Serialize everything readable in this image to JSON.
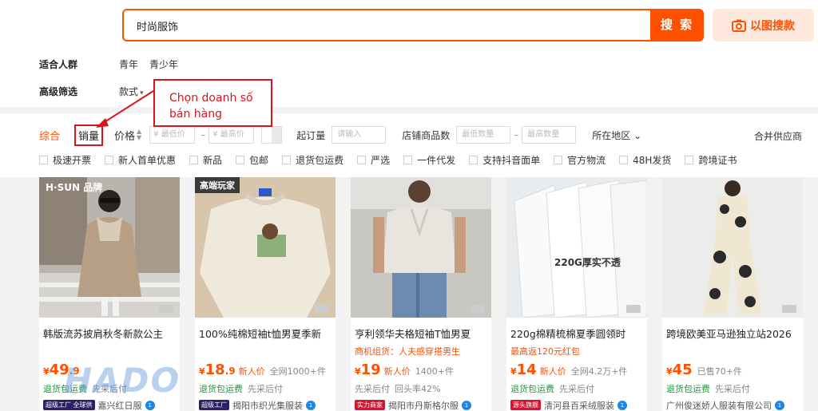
{
  "search": {
    "query": "时尚服饰",
    "button": "搜 索",
    "image_search": "以图搜款"
  },
  "filters": {
    "row1": {
      "label": "适合人群",
      "options": [
        "青年",
        "青少年"
      ]
    },
    "row2": {
      "label": "高级筛选",
      "options": [
        "款式"
      ]
    }
  },
  "sort": {
    "comprehensive": "综合",
    "sales": "销量",
    "price": "价格",
    "price_min_placeholder": "¥ 最低价",
    "price_max_placeholder": "¥ 最高价",
    "moq_label": "起订量",
    "moq_placeholder": "请输入",
    "shop_count_label": "店铺商品数",
    "min_qty_placeholder": "最低数量",
    "max_qty_placeholder": "最高数量",
    "region": "所在地区",
    "merge_supplier": "合并供应商"
  },
  "checks": [
    "极速开票",
    "新人首单优惠",
    "新品",
    "包邮",
    "退货包运费",
    "严选",
    "一件代发",
    "支持抖音面单",
    "官方物流",
    "48H发货",
    "跨境证书"
  ],
  "annotation": {
    "line1": "Chọn doanh số",
    "line2": "bán hàng"
  },
  "products": [
    {
      "title": "韩版流苏披肩秋冬新款公主",
      "sub": "",
      "price_int": "49",
      "price_dec": ".9",
      "badge": "",
      "sold": "",
      "tag": "退货包运费",
      "tag2": "先采后付",
      "shop_tag": "超级工厂 全球供",
      "shop": "嘉兴红日服",
      "img_text": "H·SUN 品牌"
    },
    {
      "title": "100%纯棉短袖t恤男夏季新",
      "sub": "",
      "price_int": "18",
      "price_dec": ".9",
      "badge": "新人价",
      "sold": "全网1000+件",
      "tag": "退货包运费",
      "tag2": "先采后付",
      "shop_tag": "超级工厂",
      "shop": "揭阳市织光集服装",
      "img_text": "高端玩家"
    },
    {
      "title": "亨利领华夫格短袖T恤男夏",
      "sub": "商机组货：人夫感穿搭男生",
      "price_int": "19",
      "price_dec": "",
      "badge": "新人价",
      "sold": "1400+件",
      "tag": "先采后付",
      "tag2": "回头率42%",
      "shop_tag": "实力商家",
      "shop": "揭阳市丹斯格尔服",
      "img_text": ""
    },
    {
      "title": "220g棉精梳棉夏季圆领时",
      "sub": "最高返120元红包",
      "price_int": "14",
      "price_dec": "",
      "badge": "新人价",
      "sold": "全网4.2万+件",
      "tag": "退货包运费",
      "tag2": "先采后付",
      "shop_tag": "源头旗舰",
      "shop": "清河县百采绒服装",
      "img_text": "220G厚实不透"
    },
    {
      "title": "跨境欧美亚马逊独立站2026",
      "sub": "",
      "price_int": "45",
      "price_dec": "",
      "badge": "",
      "sold": "已售70+件",
      "tag": "退货包运费",
      "tag2": "先采后付",
      "shop_tag": "",
      "shop": "广州俊迷娇人服装有限公司",
      "img_text": ""
    }
  ],
  "currency": "¥",
  "watermark": "HADO"
}
